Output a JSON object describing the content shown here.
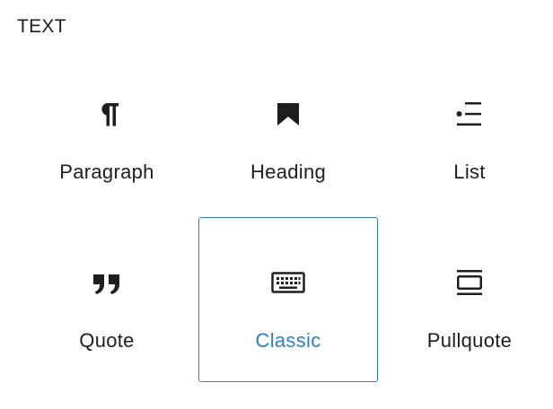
{
  "category": {
    "title": "TEXT"
  },
  "blocks": [
    {
      "label": "Paragraph",
      "icon": "paragraph-icon",
      "selected": false
    },
    {
      "label": "Heading",
      "icon": "bookmark-icon",
      "selected": false
    },
    {
      "label": "List",
      "icon": "list-icon",
      "selected": false
    },
    {
      "label": "Quote",
      "icon": "quote-icon",
      "selected": false
    },
    {
      "label": "Classic",
      "icon": "keyboard-icon",
      "selected": true
    },
    {
      "label": "Pullquote",
      "icon": "pullquote-icon",
      "selected": false
    }
  ],
  "colors": {
    "text": "#1e1e1e",
    "accent": "#2f7fbd"
  }
}
